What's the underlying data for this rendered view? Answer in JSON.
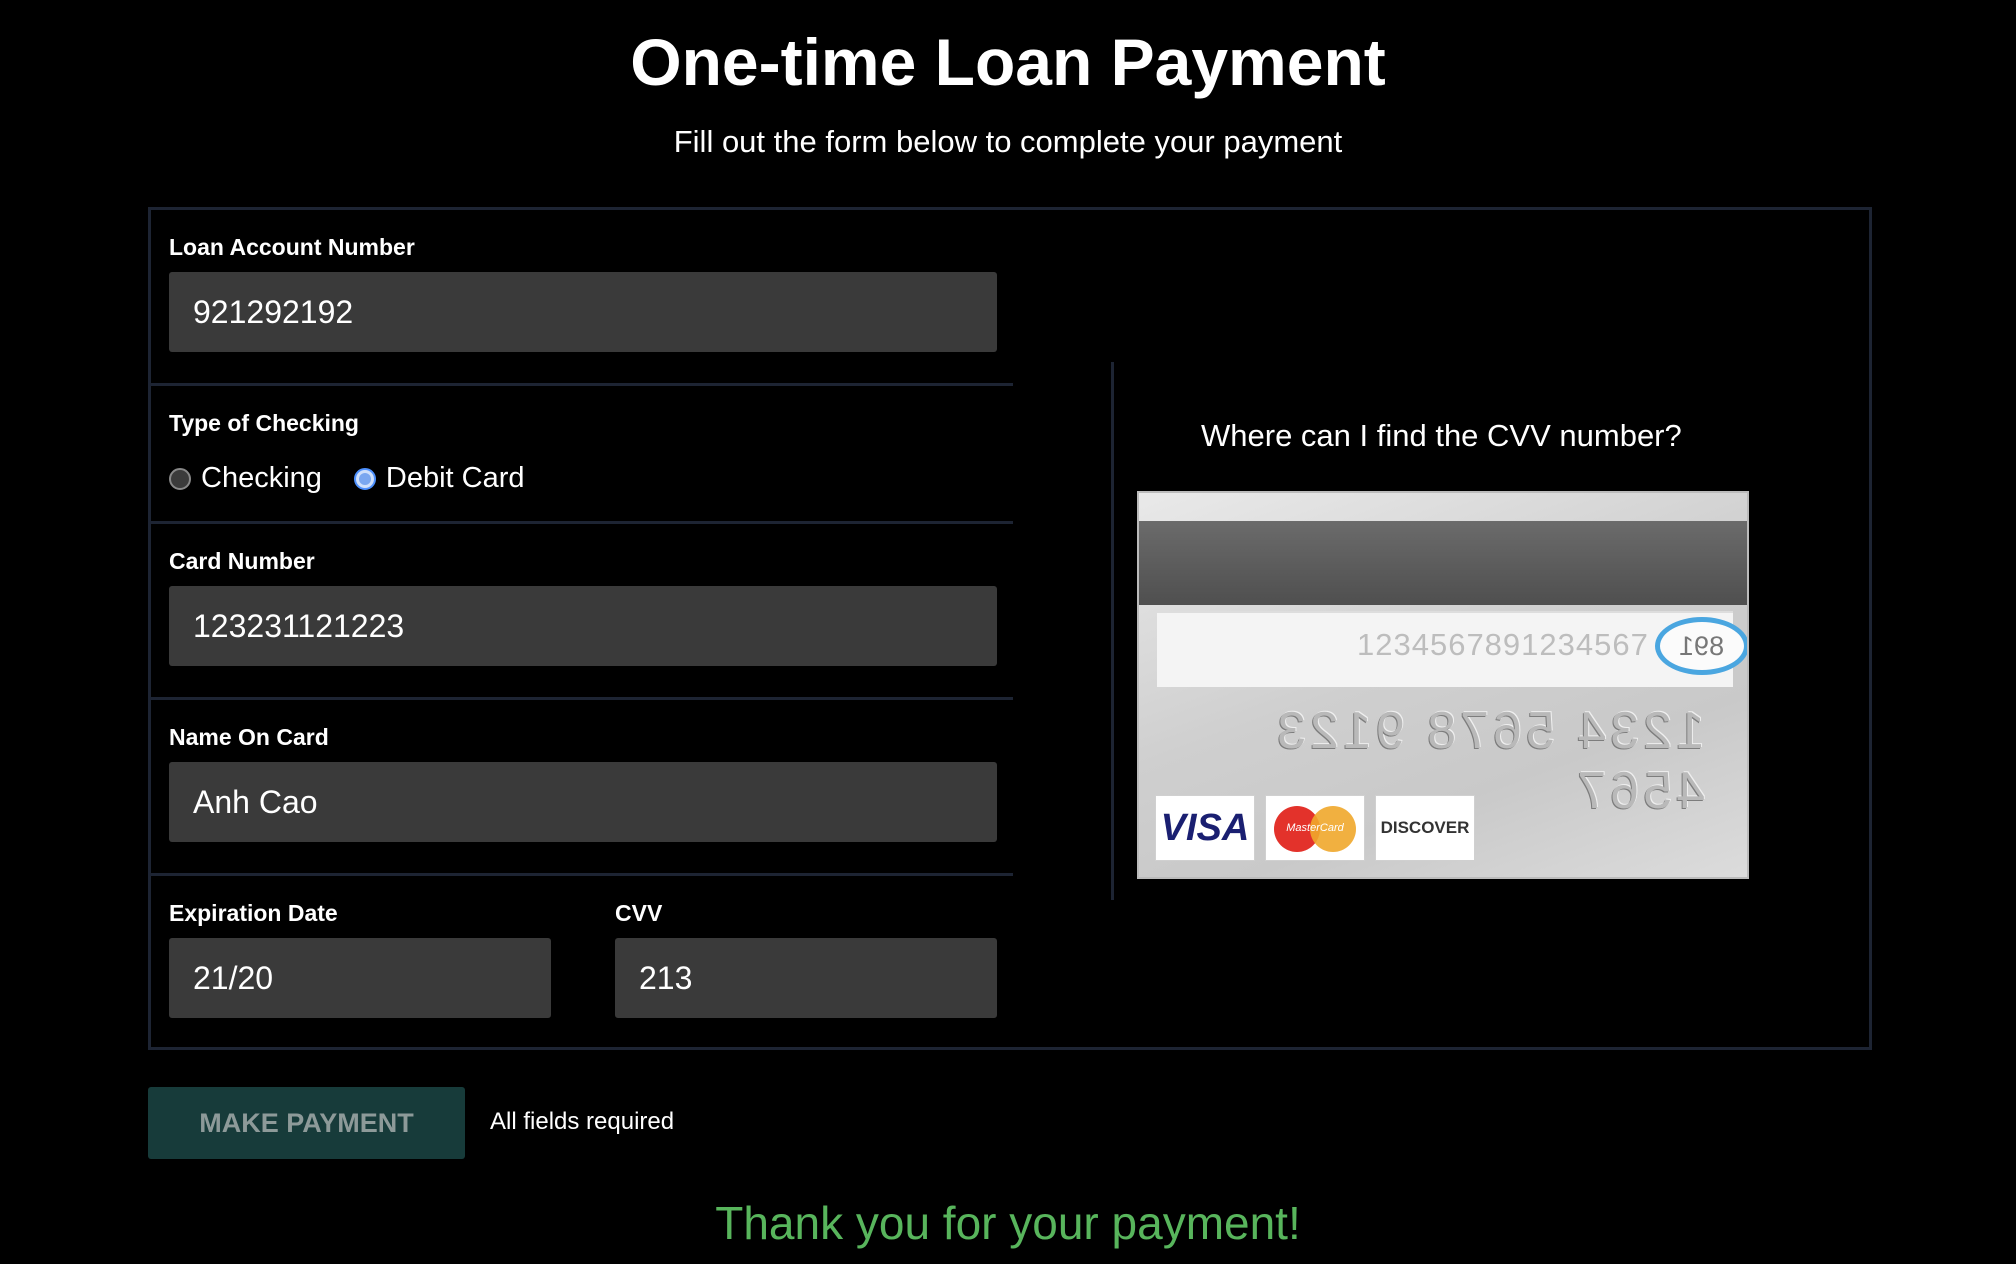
{
  "header": {
    "title": "One-time Loan Payment",
    "subtitle": "Fill out the form below to complete your payment"
  },
  "form": {
    "loan_account": {
      "label": "Loan Account Number",
      "value": "921292192"
    },
    "type_of_checking": {
      "label": "Type of Checking",
      "options": [
        {
          "label": "Checking",
          "selected": false
        },
        {
          "label": "Debit Card",
          "selected": true
        }
      ]
    },
    "card_number": {
      "label": "Card Number",
      "value": "123231121223"
    },
    "name_on_card": {
      "label": "Name On Card",
      "value": "Anh Cao"
    },
    "expiration_date": {
      "label": "Expiration Date",
      "value": "21/20"
    },
    "cvv": {
      "label": "CVV",
      "value": "213"
    }
  },
  "cvv_help": {
    "question": "Where can I find the CVV number?",
    "card_image": {
      "signature_number": "1234567891234567",
      "cvv_code": "891",
      "embossed_number": "1234 5678 9123 4567",
      "brands": [
        "VISA",
        "MasterCard",
        "DISCOVER"
      ]
    }
  },
  "actions": {
    "make_payment_label": "MAKE PAYMENT",
    "required_note": "All fields required"
  },
  "status": {
    "message": "Thank you for your payment!",
    "color": "#58b55c"
  },
  "colors": {
    "background": "#000000",
    "input_background": "#3a3a3a",
    "border": "#1d2433",
    "button_background": "#173b3a"
  }
}
